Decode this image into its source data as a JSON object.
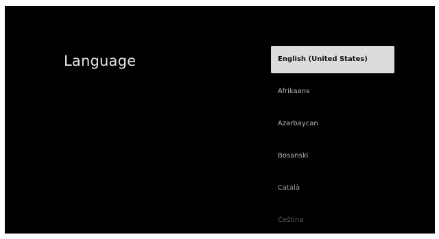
{
  "screen": {
    "title": "Language"
  },
  "languages": {
    "items": [
      {
        "label": "English (United States)",
        "selected": true
      },
      {
        "label": "Afrikaans"
      },
      {
        "label": "Azərbaycan"
      },
      {
        "label": "Bosanski"
      },
      {
        "label": "Català"
      },
      {
        "label": "Čeština"
      }
    ]
  },
  "colors": {
    "background": "#000000",
    "selected_background": "#dcdcdc",
    "selected_text": "#111111",
    "item_text": "#b9b9b9"
  }
}
